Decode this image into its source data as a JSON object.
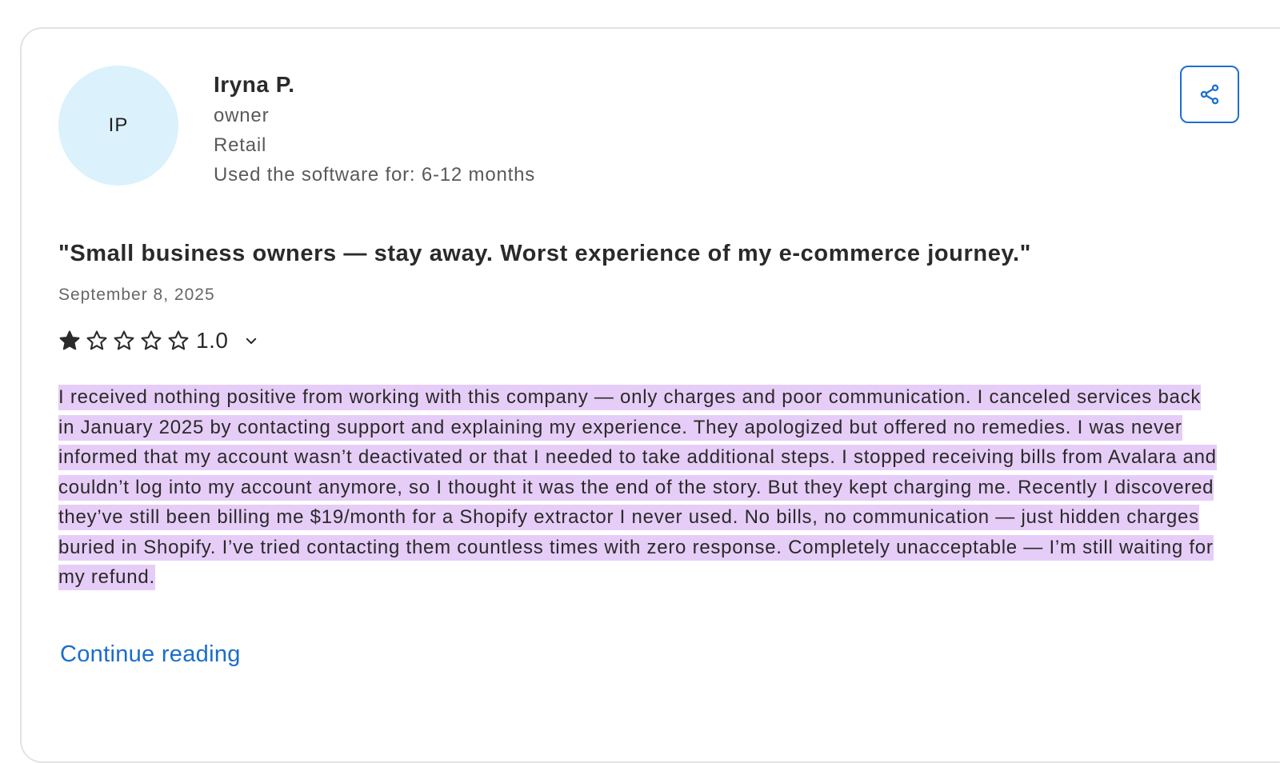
{
  "reviewer": {
    "initials": "IP",
    "name": "Iryna P.",
    "role": "owner",
    "industry": "Retail",
    "usage": "Used the software for: 6-12 months"
  },
  "review": {
    "title": "\"Small business owners — stay away. Worst experience of my e-commerce journey.\"",
    "date": "September 8, 2025",
    "rating": {
      "value": "1.0",
      "stars_filled": 1,
      "stars_total": 5
    },
    "body": "I received nothing positive from working with this company — only charges and poor communication. I canceled services back in January 2025 by contacting support and explaining my experience. They apologized but offered no remedies. I was never informed that my account wasn’t deactivated or that I needed to take additional steps. I stopped receiving bills from Avalara and couldn’t log into my account anymore, so I thought it was the end of the story. But they kept charging me. Recently I discovered they’ve still been billing me $19/month for a Shopify extractor I never used. No bills, no communication — just hidden charges buried in Shopify. I’ve tried contacting them countless times with zero response. Completely unacceptable — I’m still waiting for my refund.",
    "continue_label": "Continue reading"
  },
  "icons": {
    "share": "share-icon",
    "rating_toggle": "chevron-down-icon",
    "star_filled": "star-filled-icon",
    "star_empty": "star-outline-icon"
  },
  "colors": {
    "avatar_bg": "#dbf1fc",
    "accent": "#1a6dcc",
    "highlight": "#e6cdf7"
  }
}
